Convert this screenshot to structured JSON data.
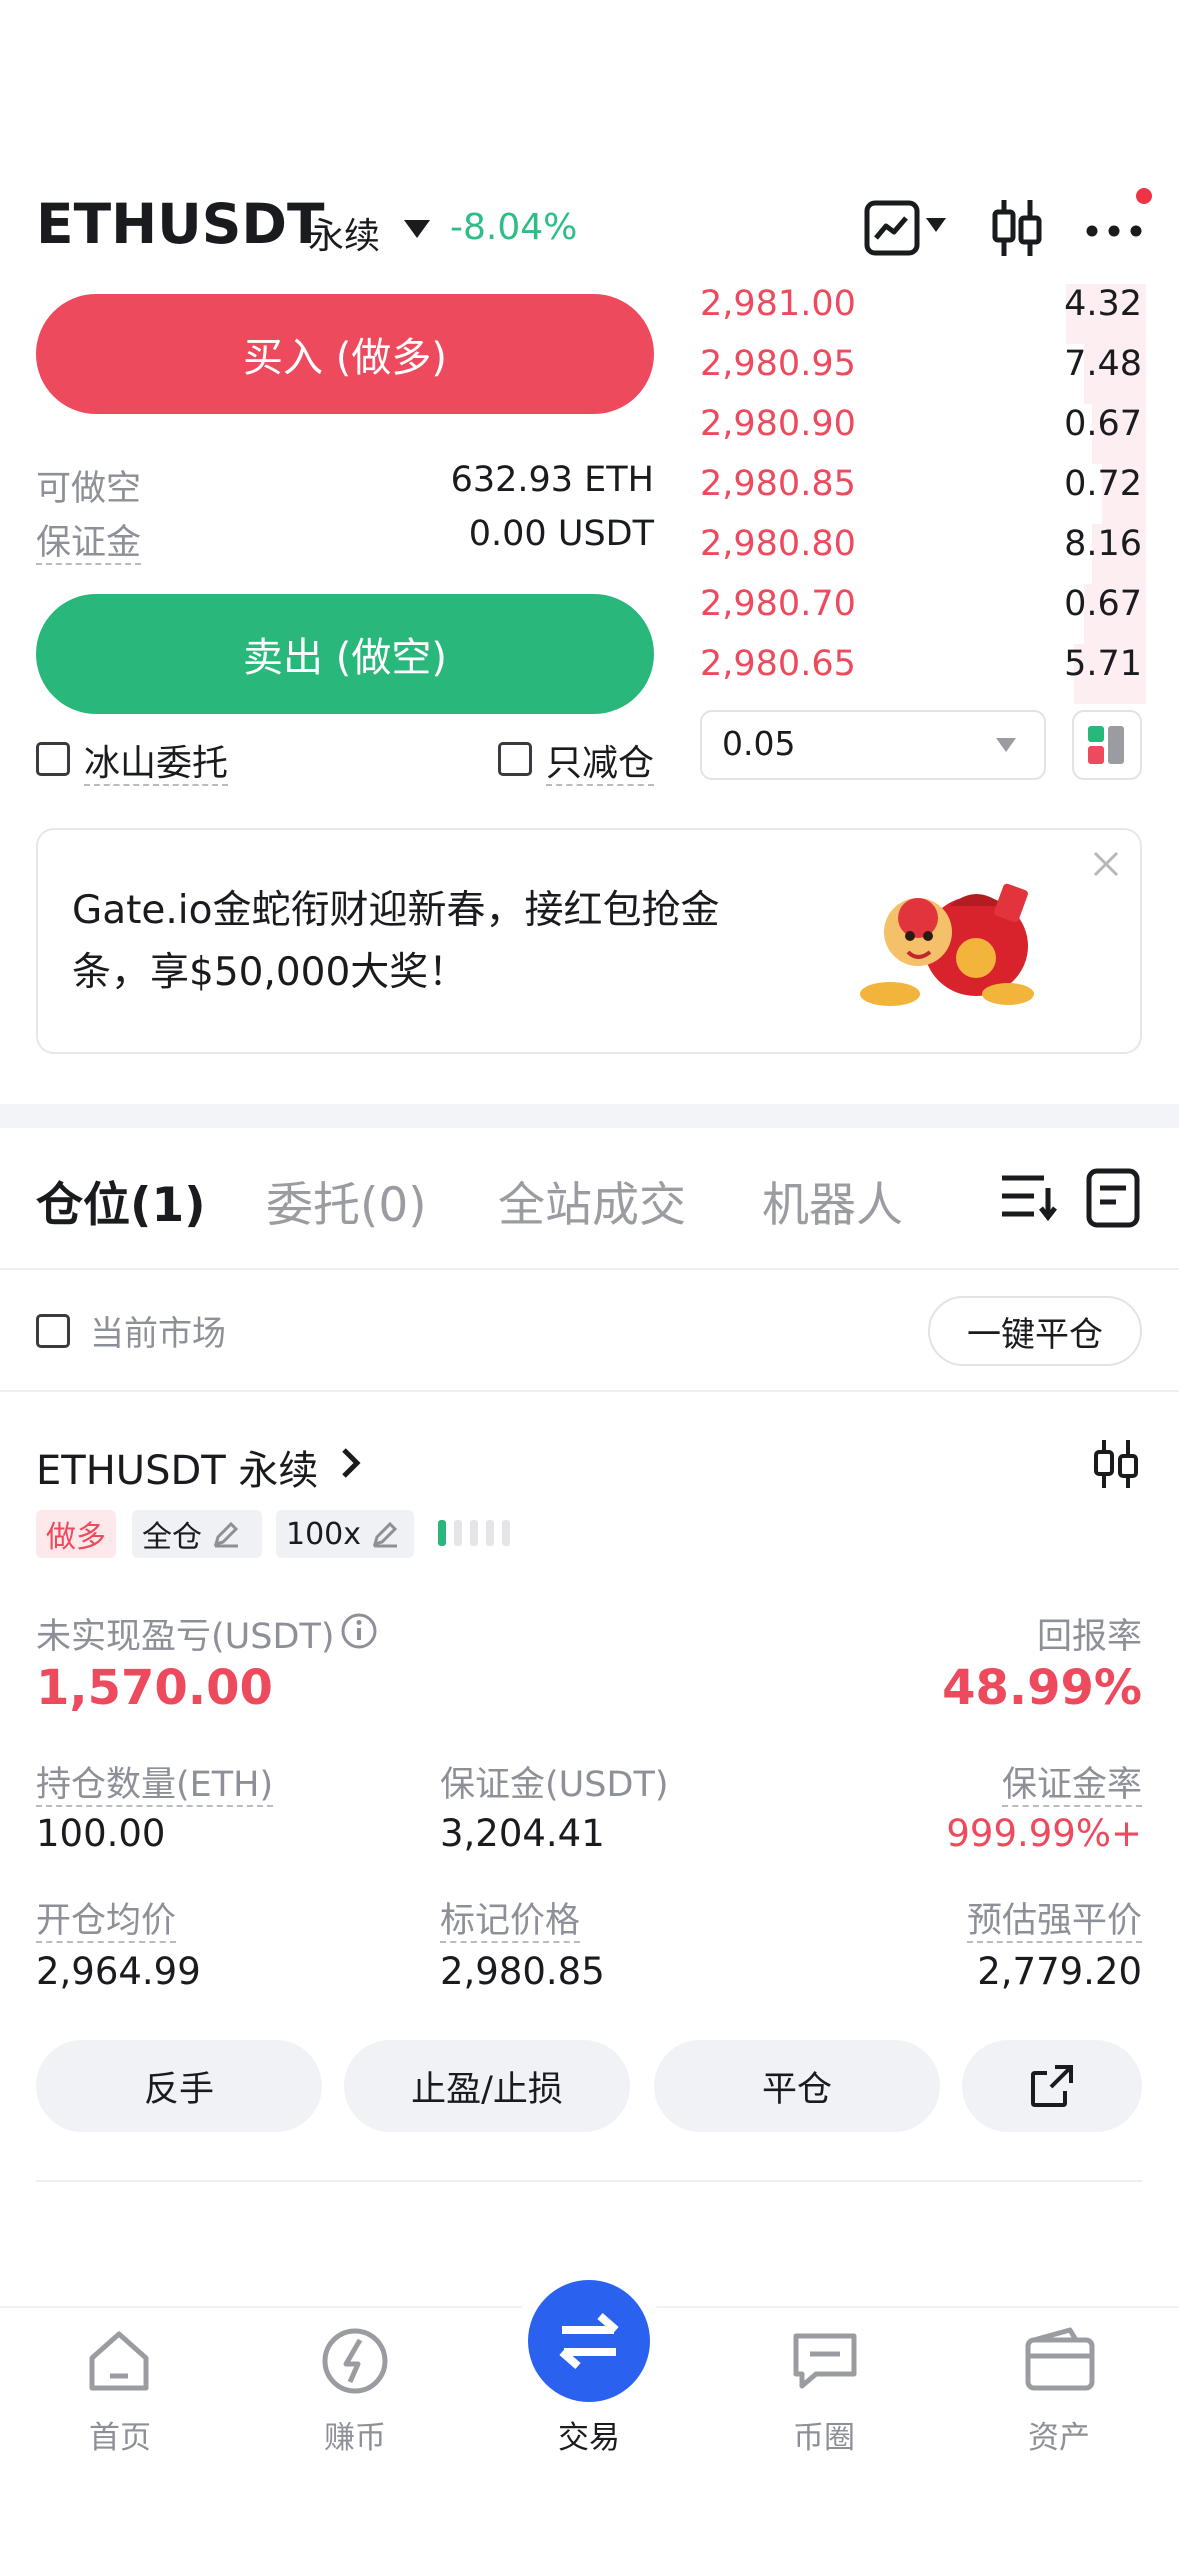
{
  "header": {
    "symbol": "ETHUSDT",
    "contract_type": "永续",
    "change": "-8.04%",
    "icons": [
      "chart-line-icon",
      "candlestick-icon",
      "more-icon"
    ]
  },
  "trade": {
    "buy_label": "买入 (做多)",
    "sell_label": "卖出 (做空)",
    "available_label": "可做空",
    "available_value": "632.93 ETH",
    "margin_label": "保证金",
    "margin_value": "0.00 USDT",
    "iceberg_label": "冰山委托",
    "reduce_only_label": "只减仓"
  },
  "orderbook": {
    "asks": [
      {
        "price": "2,981.00",
        "qty": "4.32",
        "depth": 0.18
      },
      {
        "price": "2,980.95",
        "qty": "7.48",
        "depth": 0.14
      },
      {
        "price": "2,980.90",
        "qty": "0.67",
        "depth": 0.12
      },
      {
        "price": "2,980.85",
        "qty": "0.72",
        "depth": 0.1
      },
      {
        "price": "2,980.80",
        "qty": "8.16",
        "depth": 0.12
      },
      {
        "price": "2,980.70",
        "qty": "0.67",
        "depth": 0.14
      },
      {
        "price": "2,980.65",
        "qty": "5.71",
        "depth": 0.16
      }
    ],
    "precision": "0.05"
  },
  "banner": {
    "text": "Gate.io金蛇衔财迎新春，接红包抢金条，享$50,000大奖！"
  },
  "tabs": [
    {
      "label": "仓位(1)",
      "active": true
    },
    {
      "label": "委托(0)",
      "active": false
    },
    {
      "label": "全站成交",
      "active": false
    },
    {
      "label": "机器人",
      "active": false
    }
  ],
  "filter": {
    "current_market_label": "当前市场",
    "close_all_label": "一键平仓"
  },
  "position": {
    "title": "ETHUSDT 永续",
    "side_tag": "做多",
    "margin_mode": "全仓",
    "leverage": "100x",
    "unrealized_pnl_label": "未实现盈亏(USDT)",
    "unrealized_pnl": "1,570.00",
    "roi_label": "回报率",
    "roi": "48.99%",
    "size_label": "持仓数量(ETH)",
    "size": "100.00",
    "margin_label": "保证金(USDT)",
    "margin": "3,204.41",
    "margin_ratio_label": "保证金率",
    "margin_ratio": "999.99%+",
    "entry_label": "开仓均价",
    "entry": "2,964.99",
    "mark_label": "标记价格",
    "mark": "2,980.85",
    "liq_label": "预估强平价",
    "liq": "2,779.20",
    "actions": [
      "反手",
      "止盈/止损",
      "平仓"
    ]
  },
  "nav": {
    "items": [
      {
        "label": "首页",
        "icon": "home-icon"
      },
      {
        "label": "赚币",
        "icon": "earn-icon"
      },
      {
        "label": "交易",
        "icon": "trade-icon"
      },
      {
        "label": "币圈",
        "icon": "community-icon"
      },
      {
        "label": "资产",
        "icon": "wallet-icon"
      }
    ]
  }
}
